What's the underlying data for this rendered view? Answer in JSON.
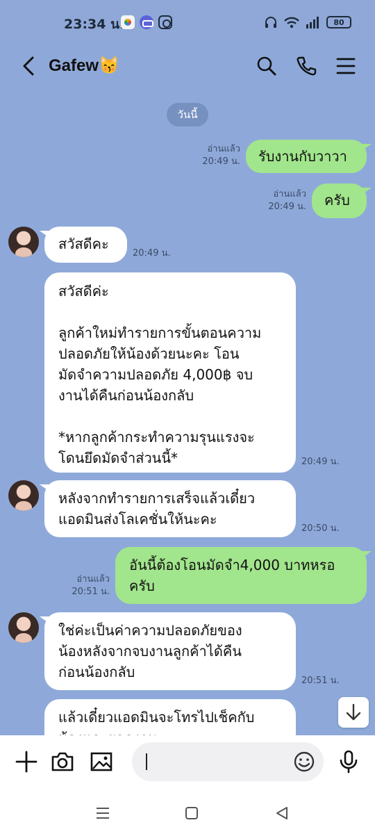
{
  "status_bar": {
    "time": "23:34 น.",
    "battery": "80"
  },
  "header": {
    "chat_name": "Gafew😽"
  },
  "date_divider": "วันนี้",
  "messages": [
    {
      "direction": "out",
      "text": "รับงานกับวาวา",
      "read": "อ่านแล้ว",
      "time": "20:49 น."
    },
    {
      "direction": "out",
      "text": "ครับ",
      "read": "อ่านแล้ว",
      "time": "20:49 น."
    },
    {
      "direction": "in",
      "text": "สวัสดีคะ",
      "time": "20:49 น."
    },
    {
      "direction": "in",
      "text": "สวัสดีค่ะ\n\nลูกค้าใหม่ทำรายการขั้นตอนความ\nปลอดภัยให้น้องด้วยนะคะ โอน\nมัดจำความปลอดภัย 4,000฿ จบ\nงานได้คืนก่อนน้องกลับ\n\n*หากลูกค้ากระทำความรุนแรงจะ\nโดนยึดมัดจำส่วนนี้*",
      "time": "20:49 น."
    },
    {
      "direction": "in",
      "text": "หลังจากทำรายการเสร็จแล้วเดี๋ยว\nแอดมินส่งโลเคชั่นให้นะคะ",
      "time": "20:50 น."
    },
    {
      "direction": "out",
      "text": "อันนี้ต้องโอนมัดจำ4,000 บาทหรอ\nครับ",
      "read": "อ่านแล้ว",
      "time": "20:51 น."
    },
    {
      "direction": "in",
      "text": "ใช่ค่ะเป็นค่าความปลอดภัยของ\nน้องหลังจากจบงานลูกค้าได้คืน\nก่อนน้องกลับ",
      "time": "20:51 น."
    },
    {
      "direction": "in",
      "text": "แล้วเดี๋ยวแอดมินจะโทรไปเช็คกับ\nน้องและยอดงาน",
      "time": ""
    }
  ],
  "input": {
    "placeholder": ""
  }
}
